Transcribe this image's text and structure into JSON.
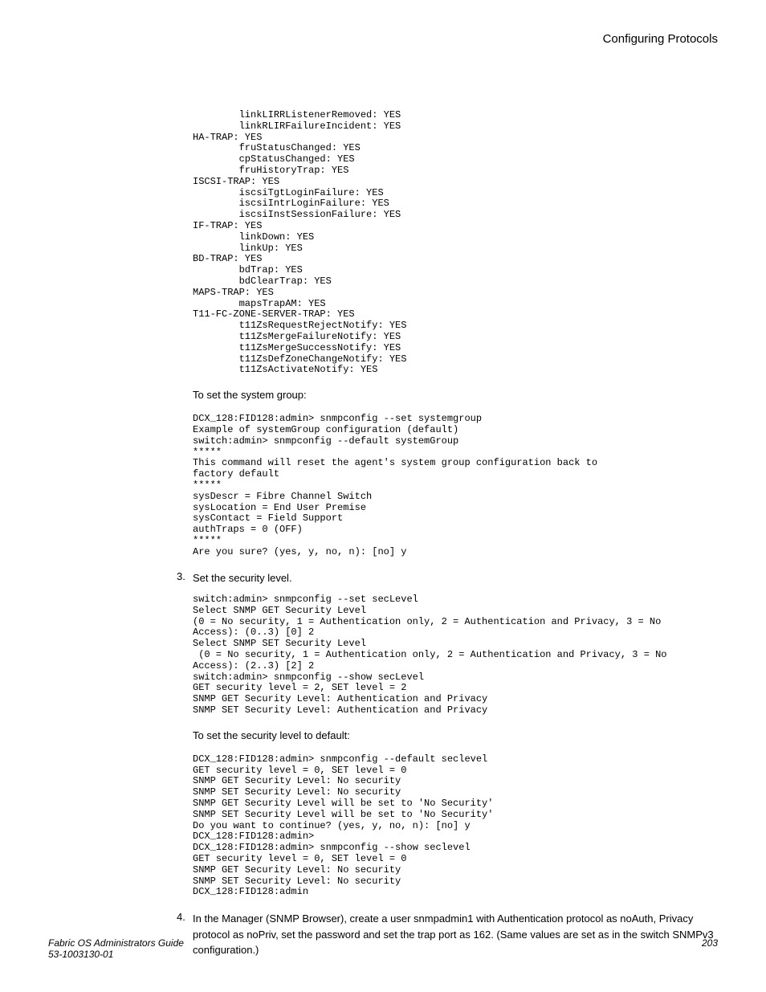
{
  "header": {
    "title": "Configuring Protocols"
  },
  "codeBlock1": "        linkLIRRListenerRemoved: YES\n        linkRLIRFailureIncident: YES\nHA-TRAP: YES\n        fruStatusChanged: YES\n        cpStatusChanged: YES\n        fruHistoryTrap: YES\nISCSI-TRAP: YES\n        iscsiTgtLoginFailure: YES\n        iscsiIntrLoginFailure: YES\n        iscsiInstSessionFailure: YES\nIF-TRAP: YES\n        linkDown: YES\n        linkUp: YES\nBD-TRAP: YES\n        bdTrap: YES\n        bdClearTrap: YES\nMAPS-TRAP: YES\n        mapsTrapAM: YES\nT11-FC-ZONE-SERVER-TRAP: YES\n        t11ZsRequestRejectNotify: YES\n        t11ZsMergeFailureNotify: YES\n        t11ZsMergeSuccessNotify: YES\n        t11ZsDefZoneChangeNotify: YES\n        t11ZsActivateNotify: YES",
  "label1": "To set the system group:",
  "codeBlock2": "DCX_128:FID128:admin> snmpconfig --set systemgroup\nExample of systemGroup configuration (default)\nswitch:admin> snmpconfig --default systemGroup\n*****\nThis command will reset the agent's system group configuration back to\nfactory default\n*****\nsysDescr = Fibre Channel Switch\nsysLocation = End User Premise\nsysContact = Field Support\nauthTraps = 0 (OFF)\n*****\nAre you sure? (yes, y, no, n): [no] y",
  "step3": {
    "num": "3.",
    "text": "Set the security level."
  },
  "codeBlock3": "switch:admin> snmpconfig --set secLevel\nSelect SNMP GET Security Level\n(0 = No security, 1 = Authentication only, 2 = Authentication and Privacy, 3 = No\nAccess): (0..3) [0] 2\nSelect SNMP SET Security Level\n (0 = No security, 1 = Authentication only, 2 = Authentication and Privacy, 3 = No\nAccess): (2..3) [2] 2\nswitch:admin> snmpconfig --show secLevel\nGET security level = 2, SET level = 2\nSNMP GET Security Level: Authentication and Privacy\nSNMP SET Security Level: Authentication and Privacy",
  "label2": "To set the security level to default:",
  "codeBlock4": "DCX_128:FID128:admin> snmpconfig --default seclevel\nGET security level = 0, SET level = 0\nSNMP GET Security Level: No security\nSNMP SET Security Level: No security\nSNMP GET Security Level will be set to 'No Security'\nSNMP SET Security Level will be set to 'No Security'\nDo you want to continue? (yes, y, no, n): [no] y\nDCX_128:FID128:admin>\nDCX_128:FID128:admin> snmpconfig --show seclevel\nGET security level = 0, SET level = 0\nSNMP GET Security Level: No security\nSNMP SET Security Level: No security\nDCX_128:FID128:admin",
  "step4": {
    "num": "4.",
    "text": "In the Manager (SNMP Browser), create a user snmpadmin1 with Authentication protocol as noAuth, Privacy protocol as noPriv, set the password and set the trap port as 162. (Same values are set as in the switch SNMPv3 configuration.)"
  },
  "footer": {
    "left1": "Fabric OS Administrators Guide",
    "left2": "53-1003130-01",
    "right": "203"
  }
}
